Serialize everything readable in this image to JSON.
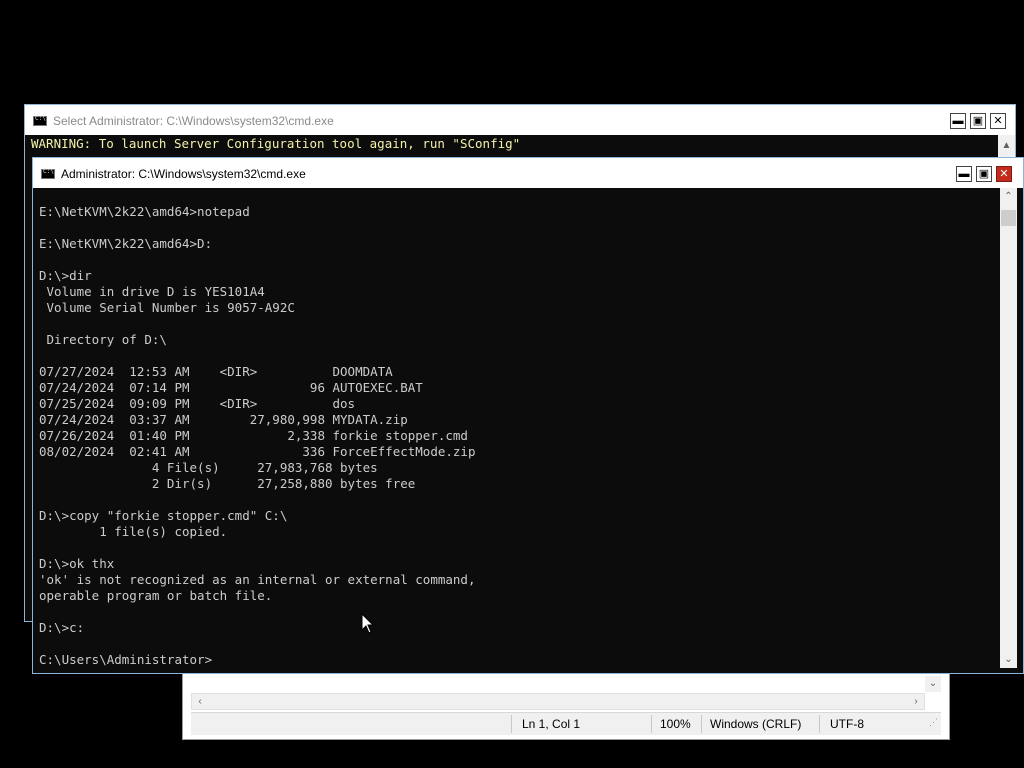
{
  "back_window": {
    "title": "Select Administrator: C:\\Windows\\system32\\cmd.exe",
    "lines": [
      "WARNING: To launch Server Configuration tool again, run \"SConfig\""
    ],
    "scroll_up_glyph": "▲",
    "buttons": {
      "minimize": "▬",
      "maximize": "▣",
      "close": "✕"
    }
  },
  "notepad": {
    "status": {
      "position": "Ln 1, Col 1",
      "zoom": "100%",
      "line_endings": "Windows (CRLF)",
      "encoding": "UTF-8"
    },
    "scroll_down_glyph": "⌄",
    "scroll_left_glyph": "‹",
    "scroll_right_glyph": "›"
  },
  "front_window": {
    "title": "Administrator: C:\\Windows\\system32\\cmd.exe",
    "buttons": {
      "minimize": "▬",
      "maximize": "▣",
      "close": "✕"
    },
    "scroll_up_glyph": "⌃",
    "scroll_down_glyph": "⌄",
    "lines": [
      "E:\\NetKVM\\2k22\\amd64>notepad",
      "",
      "E:\\NetKVM\\2k22\\amd64>D:",
      "",
      "D:\\>dir",
      " Volume in drive D is YES101A4",
      " Volume Serial Number is 9057-A92C",
      "",
      " Directory of D:\\",
      "",
      "07/27/2024  12:53 AM    <DIR>          DOOMDATA",
      "07/24/2024  07:14 PM                96 AUTOEXEC.BAT",
      "07/25/2024  09:09 PM    <DIR>          dos",
      "07/24/2024  03:37 AM        27,980,998 MYDATA.zip",
      "07/26/2024  01:40 PM             2,338 forkie stopper.cmd",
      "08/02/2024  02:41 AM               336 ForceEffectMode.zip",
      "               4 File(s)     27,983,768 bytes",
      "               2 Dir(s)      27,258,880 bytes free",
      "",
      "D:\\>copy \"forkie stopper.cmd\" C:\\",
      "        1 file(s) copied.",
      "",
      "D:\\>ok thx",
      "'ok' is not recognized as an internal or external command,",
      "operable program or batch file.",
      "",
      "D:\\>c:",
      "",
      "C:\\Users\\Administrator>"
    ]
  },
  "mouse_cursor": "arrow-pointer"
}
